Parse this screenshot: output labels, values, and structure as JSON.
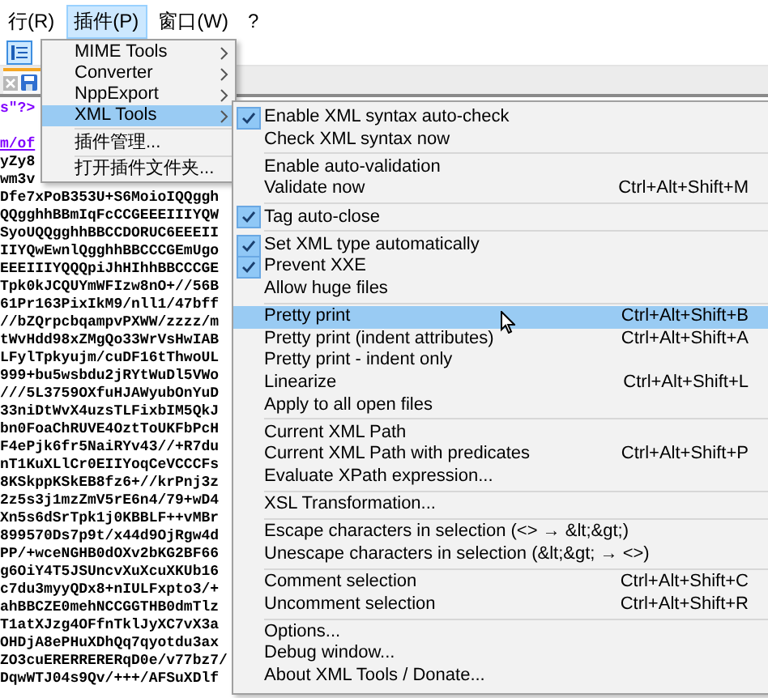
{
  "menu_bar": [
    {
      "label": "行(R)",
      "selected": false
    },
    {
      "label": "插件(P)",
      "selected": true
    },
    {
      "label": "窗口(W)",
      "selected": false
    },
    {
      "label": "?",
      "selected": false
    }
  ],
  "editor": {
    "lines": [
      {
        "kind": "tag",
        "text": "s\"?>"
      },
      {
        "kind": "blank"
      },
      {
        "kind": "link",
        "text": "m/of"
      },
      {
        "kind": "code",
        "text": "yZy8"
      },
      {
        "kind": "code",
        "text": "wm3v"
      },
      {
        "kind": "code",
        "text": "Dfe7xPoB353U+S6MoioIQQggh"
      },
      {
        "kind": "code",
        "text": "QQgghhBBmIqFcCCGEEEIIIYQW"
      },
      {
        "kind": "code",
        "text": "SyoUQQgghhBBCCDORUC6EEEII"
      },
      {
        "kind": "code",
        "text": "IIYQwEwnlQgghhBBCCCGEmUgo"
      },
      {
        "kind": "code",
        "text": "EEEIIIYQQQpiJhHIhhBBCCCGE"
      },
      {
        "kind": "code",
        "text": "Tpk0kJCQUYmWFIzw8nO+//56B"
      },
      {
        "kind": "code",
        "text": "61Pr163PixIkM9/nll1/47bff"
      },
      {
        "kind": "code",
        "text": "//bZQrpcbqampvPXWW/zzzz/m"
      },
      {
        "kind": "code",
        "text": "tWvHdd98xZMgQo33WrVsHwIAB"
      },
      {
        "kind": "code",
        "text": "LFylTpkyujm/cuDF16tThwoUL"
      },
      {
        "kind": "code",
        "text": "999+bu5wsbdu2jRYtWuDl5VWo"
      },
      {
        "kind": "code",
        "text": "///5L3759OXfuHJAWyubOnYuD"
      },
      {
        "kind": "code",
        "text": "33niDtWvX4uzsTLFixbIM5QkJ"
      },
      {
        "kind": "code",
        "text": "bn0FoaChRUVE4OztToUKFbPcH"
      },
      {
        "kind": "code",
        "text": "F4ePjk6fr5NaiRYv43//+R7du"
      },
      {
        "kind": "code",
        "text": "nT1KuXLlCr0EIIYoqCeVCCCFs"
      },
      {
        "kind": "code",
        "text": "8KSkppKSkEB8fz6+//krPnj3z"
      },
      {
        "kind": "code",
        "text": "2z5s3j1mzZmV5rE6n4/79+wD4"
      },
      {
        "kind": "code",
        "text": "Xn5s6dSrTpk1j0KBBLF++vMBr"
      },
      {
        "kind": "code",
        "text": "899570Ds7p9t/x44d9OjRgw4d"
      },
      {
        "kind": "code",
        "text": "PP/+wceNGHB0dOXv2bKG2BF66"
      },
      {
        "kind": "code",
        "text": "g6OiY4T5JSUncvXuXcuXKUb16"
      },
      {
        "kind": "code",
        "text": "c7du3myyQDx8+nIULFxpto3/+"
      },
      {
        "kind": "code",
        "text": "ahBBCZE0mehNCCGGTHB0dmTlz"
      },
      {
        "kind": "code",
        "text": "T1atXJzg4OFfnTklJyXC7vX3a"
      },
      {
        "kind": "code",
        "text": "OHDjA8ePHuXDhQq7qyotdu3ax"
      },
      {
        "kind": "code",
        "text": "ZO3cuERERRERERqD0e/v77bz7/"
      },
      {
        "kind": "code",
        "text": "DqwWTJ04s9Qv/+++/AFSuXDlf"
      }
    ]
  },
  "plugins_menu": {
    "items": [
      {
        "kind": "submenu",
        "label": "MIME Tools",
        "selected": false
      },
      {
        "kind": "submenu",
        "label": "Converter",
        "selected": false
      },
      {
        "kind": "submenu",
        "label": "NppExport",
        "selected": false
      },
      {
        "kind": "submenu",
        "label": "XML Tools",
        "selected": true
      },
      {
        "kind": "separator"
      },
      {
        "kind": "command",
        "label": "插件管理...",
        "selected": false
      },
      {
        "kind": "separator"
      },
      {
        "kind": "command",
        "label": "打开插件文件夹...",
        "selected": false
      }
    ]
  },
  "xml_tools_menu": {
    "items": [
      {
        "kind": "command",
        "label": "Enable XML syntax auto-check",
        "checked": true,
        "selected": false
      },
      {
        "kind": "command",
        "label": "Check XML syntax now",
        "checked": false,
        "selected": false
      },
      {
        "kind": "separator"
      },
      {
        "kind": "command",
        "label": "Enable auto-validation",
        "checked": false,
        "selected": false
      },
      {
        "kind": "command",
        "label": "Validate now",
        "shortcut": "Ctrl+Alt+Shift+M",
        "checked": false,
        "selected": false
      },
      {
        "kind": "separator"
      },
      {
        "kind": "command",
        "label": "Tag auto-close",
        "checked": true,
        "selected": false
      },
      {
        "kind": "separator"
      },
      {
        "kind": "command",
        "label": "Set XML type automatically",
        "checked": true,
        "selected": false
      },
      {
        "kind": "command",
        "label": "Prevent XXE",
        "checked": true,
        "selected": false
      },
      {
        "kind": "command",
        "label": "Allow huge files",
        "checked": false,
        "selected": false
      },
      {
        "kind": "separator"
      },
      {
        "kind": "command",
        "label": "Pretty print",
        "shortcut": "Ctrl+Alt+Shift+B",
        "checked": false,
        "selected": true
      },
      {
        "kind": "command",
        "label": "Pretty print (indent attributes)",
        "shortcut": "Ctrl+Alt+Shift+A",
        "checked": false,
        "selected": false
      },
      {
        "kind": "command",
        "label": "Pretty print - indent only",
        "checked": false,
        "selected": false
      },
      {
        "kind": "command",
        "label": "Linearize",
        "shortcut": "Ctrl+Alt+Shift+L",
        "checked": false,
        "selected": false
      },
      {
        "kind": "command",
        "label": "Apply to all open files",
        "checked": false,
        "selected": false
      },
      {
        "kind": "separator"
      },
      {
        "kind": "command",
        "label": "Current XML Path",
        "checked": false,
        "selected": false
      },
      {
        "kind": "command",
        "label": "Current XML Path with predicates",
        "shortcut": "Ctrl+Alt+Shift+P",
        "checked": false,
        "selected": false
      },
      {
        "kind": "command",
        "label": "Evaluate XPath expression...",
        "checked": false,
        "selected": false
      },
      {
        "kind": "separator"
      },
      {
        "kind": "command",
        "label": "XSL Transformation...",
        "checked": false,
        "selected": false
      },
      {
        "kind": "separator"
      },
      {
        "kind": "command",
        "label": "Escape characters in selection (<> → &lt;&gt;)",
        "checked": false,
        "selected": false
      },
      {
        "kind": "command",
        "label": "Unescape characters in selection (&lt;&gt; → <>)",
        "checked": false,
        "selected": false
      },
      {
        "kind": "separator"
      },
      {
        "kind": "command",
        "label": "Comment selection",
        "shortcut": "Ctrl+Alt+Shift+C",
        "checked": false,
        "selected": false
      },
      {
        "kind": "command",
        "label": "Uncomment selection",
        "shortcut": "Ctrl+Alt+Shift+R",
        "checked": false,
        "selected": false
      },
      {
        "kind": "separator"
      },
      {
        "kind": "command",
        "label": "Options...",
        "checked": false,
        "selected": false
      },
      {
        "kind": "command",
        "label": "Debug window...",
        "checked": false,
        "selected": false
      },
      {
        "kind": "command",
        "label": "About XML Tools / Donate...",
        "checked": false,
        "selected": false
      }
    ]
  }
}
